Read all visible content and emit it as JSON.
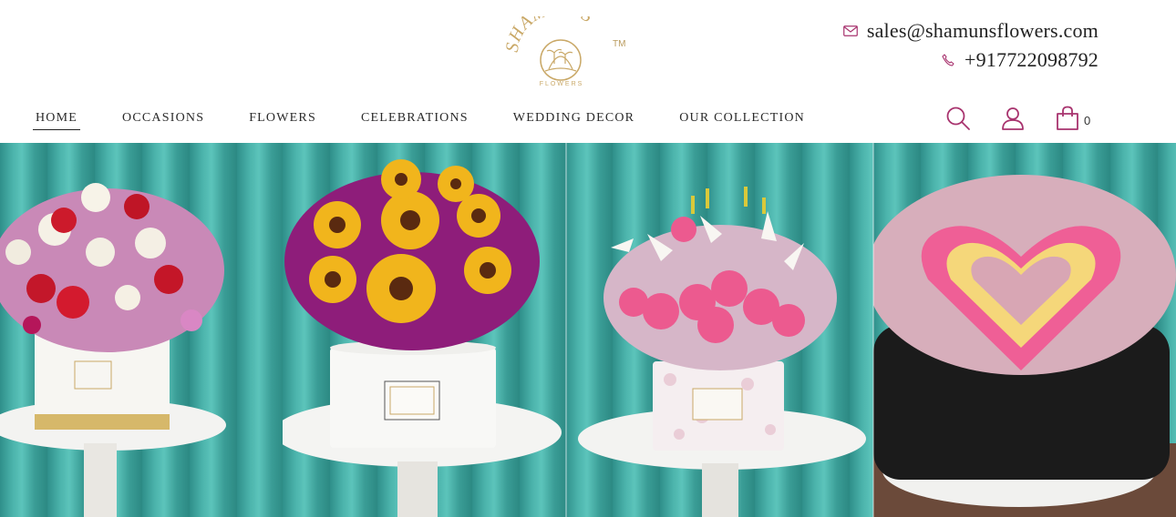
{
  "brand": {
    "logo_text": "SHAMUN'S",
    "logo_subtext": "FLOWERS",
    "tm": "TM"
  },
  "contact": {
    "email": "sales@shamunsflowers.com",
    "phone": "+917722098792"
  },
  "nav": {
    "items": [
      {
        "label": "HOME",
        "active": true
      },
      {
        "label": "OCCASIONS",
        "active": false
      },
      {
        "label": "FLOWERS",
        "active": false
      },
      {
        "label": "CELEBRATIONS",
        "active": false
      },
      {
        "label": "WEDDING DECOR",
        "active": false
      },
      {
        "label": "OUR COLLECTION",
        "active": false
      }
    ]
  },
  "tools": {
    "search_icon": "search-icon",
    "account_icon": "user-icon",
    "cart_icon": "shopping-bag-icon",
    "cart_count": "0"
  },
  "colors": {
    "accent": "#a8336e",
    "logo_gold": "#c9a867",
    "curtain_teal": "#3fa79f"
  },
  "hero": {
    "images": [
      "red-white-roses-carnations-in-white-box",
      "sunflowers-purple-flowers-in-round-white-box",
      "pink-roses-lilies-in-floral-box",
      "heart-of-pink-and-yellow-roses-in-black-box"
    ]
  }
}
